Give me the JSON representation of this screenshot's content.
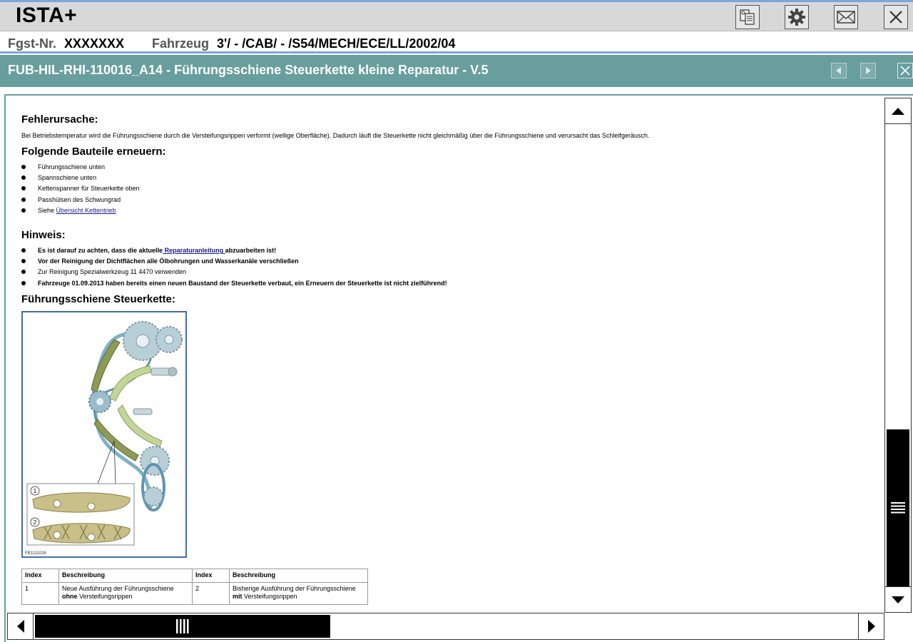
{
  "app": {
    "title": "ISTA+",
    "toolbar": [
      "documents-icon",
      "gear-icon",
      "mail-icon",
      "close-icon"
    ]
  },
  "vehicle": {
    "fgst_label": "Fgst-Nr.",
    "fgst_value": "XXXXXXX",
    "fahrzeug_label": "Fahrzeug",
    "fahrzeug_value": "3'/ - /CAB/ - /S54/MECH/ECE/LL/2002/04"
  },
  "document": {
    "title": "FUB-HIL-RHI-110016_A14 - Führungsschiene Steuerkette kleine Reparatur - V.5",
    "sections": {
      "cause_heading": "Fehlerursache:",
      "cause_text": "Bei Betriebstemperatur wird die Führungsschiene durch die Versteifungsrippen verformt (wellige Oberfläche). Dadurch läuft die Steuerkette nicht gleichmäßig über die Führungsschiene und verursacht das Schleifgeräusch.",
      "parts_heading": "Folgende Bauteile erneuern:",
      "parts": [
        "Führungsschiene unten",
        "Spannschiene unten",
        "Kettenspanner für Steuerkette oben",
        "Passhülsen des Schwungrad"
      ],
      "parts_see_prefix": "Siehe ",
      "parts_see_link": "Übersicht Kettentrieb",
      "note_heading": "Hinweis:",
      "note_1_prefix": "Es ist darauf zu achten, dass die aktuelle",
      "note_1_link": " Reparaturanleitung ",
      "note_1_suffix": "abzuarbeiten ist!",
      "note_2": "Vor der Reinigung der Dichtflächen alle Ölbohrungen und Wasserkanäle verschließen",
      "note_3": "Zur Reinigung Spezialwerkzeug 11 4470 verwenden",
      "note_4": "Fahrzeuge 01.09.2013 haben bereits einen neuen Baustand der Steuerkette verbaut, ein Erneuern der Steuerkette ist nicht zielführend!",
      "figure_heading": "Führungsschiene Steuerkette:",
      "figure_id": "FB1111026",
      "figure_callouts": [
        "1",
        "2"
      ]
    },
    "legend": {
      "headers": [
        "Index",
        "Beschreibung",
        "Index",
        "Beschreibung"
      ],
      "row": {
        "index_1": "1",
        "desc_1_line1": "Neue Ausführung der Führungsschiene",
        "desc_1_bold": "ohne",
        "desc_1_rest": " Versteifungsrippen",
        "index_2": "2",
        "desc_2_line1": "Bisherige Ausführung der Führungsschiene",
        "desc_2_bold": "mit",
        "desc_2_rest": " Versteifungsrippen"
      }
    }
  },
  "colors": {
    "header_teal": "#689e9e",
    "accent_blue": "#7aa7d6",
    "link": "#1a1a8c"
  }
}
